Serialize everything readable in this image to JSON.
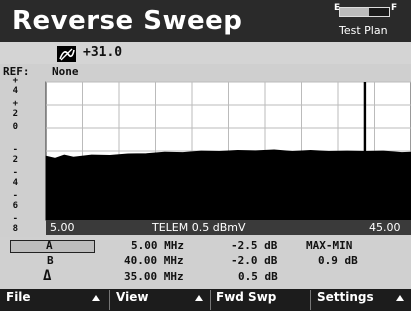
{
  "header": {
    "title": "Reverse Sweep",
    "battery_e_label": "E",
    "battery_f_label": "F",
    "battery_level": 0.6,
    "mode_label": "Test Plan"
  },
  "meter": {
    "icon": "signal-meter-icon",
    "value": "+31.0"
  },
  "reference": {
    "label": "REF:",
    "value": "None"
  },
  "plot": {
    "x_start_label": "5.00",
    "x_end_label": "45.00",
    "telemetry": "TELEM  0.5 dBmV"
  },
  "chart_data": {
    "type": "area",
    "yticks": [
      "+ 4",
      "+ 2",
      "0",
      "- 2",
      "- 4",
      "- 6",
      "- 8"
    ],
    "ylim": [
      -8,
      4
    ],
    "xlim": [
      5,
      45
    ],
    "x": [
      5,
      6,
      7,
      8,
      10,
      12,
      14,
      16,
      18,
      20,
      22,
      24,
      26,
      28,
      30,
      32,
      34,
      36,
      38,
      40,
      42,
      44,
      45
    ],
    "y": [
      -2.5,
      -2.6,
      -2.4,
      -2.5,
      -2.4,
      -2.35,
      -2.3,
      -2.2,
      -2.15,
      -2.1,
      -2.05,
      -2.0,
      -2.0,
      -1.95,
      -1.95,
      -2.0,
      -2.0,
      -2.0,
      -2.05,
      -2.0,
      -2.05,
      -2.1,
      -2.15
    ],
    "marker_x": [
      39.9,
      40.0
    ],
    "fill_color": "#000000",
    "grid": true
  },
  "markers": {
    "rows": [
      {
        "label": "A",
        "freq": "5.00 MHz",
        "level": "-2.5 dB"
      },
      {
        "label": "B",
        "freq": "40.00 MHz",
        "level": "-2.0 dB"
      },
      {
        "label": "Δ",
        "freq": "35.00 MHz",
        "level": "0.5 dB"
      }
    ],
    "summary_label": "MAX-MIN",
    "summary_value": "0.9 dB"
  },
  "softkeys": [
    {
      "label": "File"
    },
    {
      "label": "View"
    },
    {
      "label": "Fwd Swp"
    },
    {
      "label": "Settings"
    }
  ]
}
